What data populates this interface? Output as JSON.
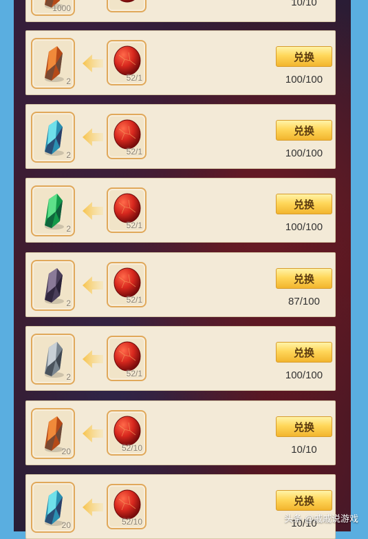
{
  "rows": [
    {
      "gem": "orange",
      "gem_qty": "1000",
      "orb_qty": "",
      "count": "10/10",
      "button": ""
    },
    {
      "gem": "orange",
      "gem_qty": "2",
      "orb_qty": "52/1",
      "count": "100/100",
      "button": "兑换"
    },
    {
      "gem": "cyan",
      "gem_qty": "2",
      "orb_qty": "52/1",
      "count": "100/100",
      "button": "兑换"
    },
    {
      "gem": "green",
      "gem_qty": "2",
      "orb_qty": "52/1",
      "count": "100/100",
      "button": "兑换"
    },
    {
      "gem": "purple",
      "gem_qty": "2",
      "orb_qty": "52/1",
      "count": "87/100",
      "button": "兑换"
    },
    {
      "gem": "gray",
      "gem_qty": "2",
      "orb_qty": "52/1",
      "count": "100/100",
      "button": "兑换"
    },
    {
      "gem": "orange",
      "gem_qty": "20",
      "orb_qty": "52/10",
      "count": "10/10",
      "button": "兑换"
    },
    {
      "gem": "cyan",
      "gem_qty": "20",
      "orb_qty": "52/10",
      "count": "10/10",
      "button": "兑换"
    }
  ],
  "watermark": "头条 @戚戚说游戏",
  "colors": {
    "orange": "#d66a2a",
    "cyan": "#2ab6c8",
    "green": "#1fae5a",
    "purple": "#5a4a6a",
    "gray": "#8a96a0",
    "orb": "#d8281e",
    "accent": "#ffd75a"
  }
}
